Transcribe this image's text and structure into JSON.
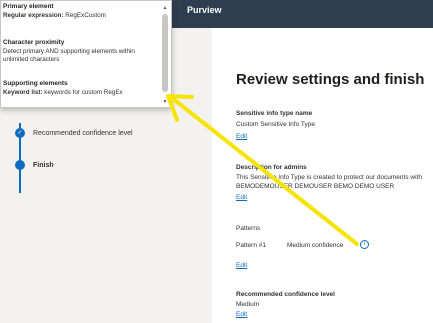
{
  "header": {
    "app_name": "Purview"
  },
  "popup": {
    "primary_title": "Primary element",
    "primary_text_label": "Regular expression:",
    "primary_text_value": "RegExCustom",
    "proximity_title": "Character proximity",
    "proximity_text": "Detect primary AND supporting elements within unlimited characters",
    "supporting_title": "Supporting elements",
    "supporting_text_label": "Keyword list:",
    "supporting_text_value": "keywords for custom RegEx"
  },
  "steps": {
    "done_label": "Recommended confidence level",
    "current_label": "Finish"
  },
  "main": {
    "title": "Review settings and finish",
    "name_label": "Sensitive info type name",
    "name_value": "Custom Sensitive Info Type",
    "description_label": "Description for admins",
    "description_line1": "This Sensitive Info Type is created to protect our documents with",
    "description_line2": "BEMODEMOUSER DEMOUSER BEMO DEMO USER",
    "patterns_label": "Patterns",
    "pattern_name": "Pattern #1",
    "pattern_confidence": "Medium confidence",
    "confidence_label": "Recommended confidence level",
    "confidence_value": "Medium",
    "edit_label": "Edit"
  },
  "colors": {
    "accent": "#0f6cbd",
    "topbar": "#2c3e50",
    "annotation_arrow": "#f5e400"
  }
}
